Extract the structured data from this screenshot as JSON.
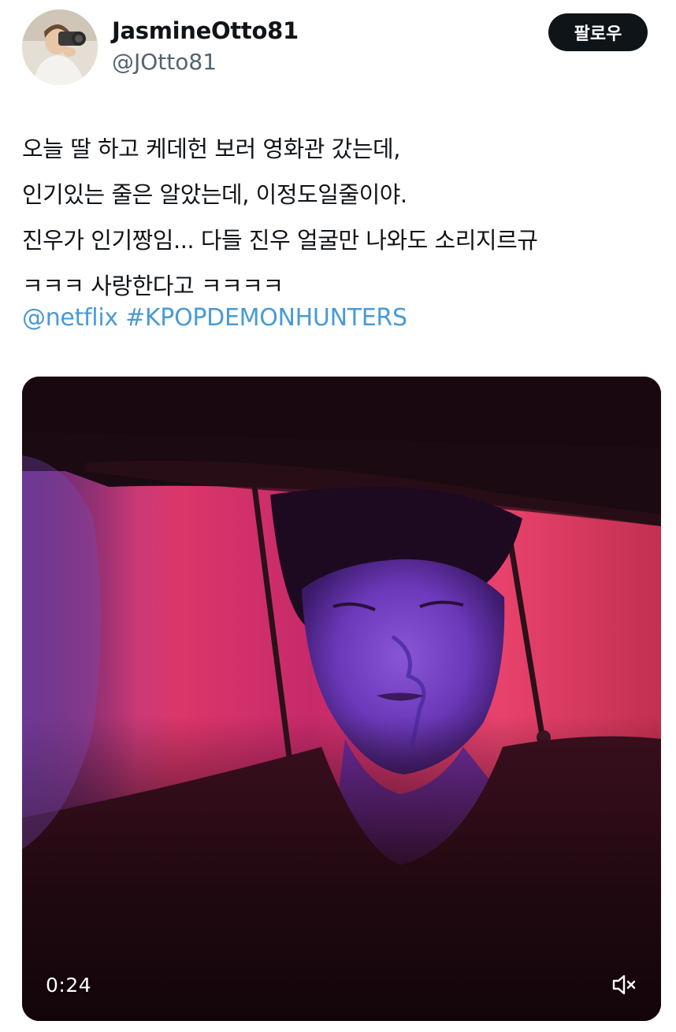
{
  "author": {
    "display_name": "JasmineOtto81",
    "handle": "@JOtto81",
    "avatar_icon": "user-avatar"
  },
  "follow_button": {
    "label": "팔로우"
  },
  "tweet": {
    "lines": [
      "오늘 딸 하고 케데헌 보러 영화관 갔는데,",
      "인기있는 줄은 알았는데, 이정도일줄이야.",
      "진우가 인기짱임... 다들 진우 얼굴만 나와도 소리지르규",
      "ㅋㅋㅋ 사랑한다고 ㅋㅋㅋㅋ"
    ],
    "mention": "@netflix",
    "hashtag": "#KPOPDEMONHUNTERS",
    "link_color": "#4a9ad6"
  },
  "media": {
    "type": "video",
    "timestamp": "0:24",
    "mute_icon": "speaker-muted-icon"
  }
}
